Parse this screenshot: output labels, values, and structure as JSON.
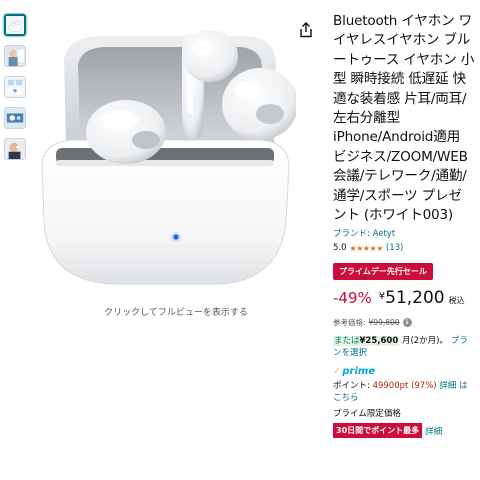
{
  "thumbnails": [
    {
      "name": "earbuds-case"
    },
    {
      "name": "earbuds-lifestyle"
    },
    {
      "name": "earbuds-spec"
    },
    {
      "name": "earbuds-sport"
    },
    {
      "name": "earbuds-wear"
    }
  ],
  "main_image": {
    "alt": "earbuds-in-charging-case"
  },
  "zoom_hint": "クリックしてフルビューを表示する",
  "product": {
    "title": "Bluetooth イヤホン ワイヤレスイヤホン ブルートゥース イヤホン 小型 瞬時接続 低遅延 快適な装着感 片耳/両耳/左右分離型 iPhone/Android適用 ビジネス/ZOOM/WEB会議/テレワーク/通勤/通学/スポーツ プレゼント (ホワイト003)",
    "brand": "ブランド: Aetyt",
    "rating": "5.0",
    "stars": "★★★★★",
    "rating_count": "(13)"
  },
  "deal": {
    "badge": "プライムデー先行セール"
  },
  "price": {
    "discount": "-49%",
    "currency": "¥",
    "amount": "51,200",
    "tax": "税込"
  },
  "reference": {
    "label": "参考価格:",
    "value": "¥99,800",
    "info": "i"
  },
  "installment": {
    "prefix": "または",
    "amount": "¥25,600",
    "suffix": "月(2か月)。",
    "link": "プランを選択"
  },
  "prime": {
    "check": "✓",
    "label": "prime"
  },
  "points": {
    "label": "ポイント:",
    "value": "49900pt",
    "percent": "(97%)",
    "link1": "詳細",
    "link2": "はこちら"
  },
  "limited": "プライム限定価格",
  "points_badge": {
    "label": "30日間でポイント最多",
    "link": "詳細"
  },
  "colors": {
    "accent": "#cc0c39",
    "link": "#007185",
    "prime": "#00a8e1",
    "star": "#de7921"
  },
  "icons": {
    "share": "share-icon"
  }
}
